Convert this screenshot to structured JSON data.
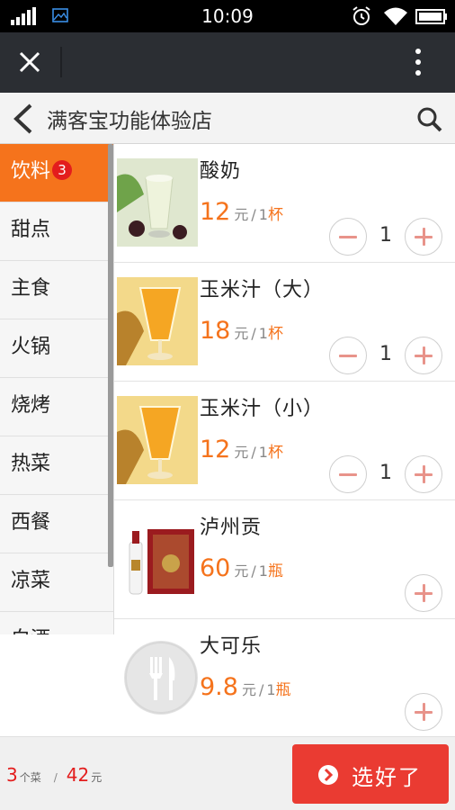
{
  "status_bar": {
    "time": "10:09"
  },
  "store": {
    "title": "满客宝功能体验店"
  },
  "categories": [
    {
      "label": "饮料",
      "badge": "3"
    },
    {
      "label": "甜点"
    },
    {
      "label": "主食"
    },
    {
      "label": "火锅"
    },
    {
      "label": "烧烤"
    },
    {
      "label": "热菜"
    },
    {
      "label": "西餐"
    },
    {
      "label": "凉菜"
    },
    {
      "label": "白酒"
    }
  ],
  "products": [
    {
      "name": "酸奶",
      "price": "12",
      "currency": "元",
      "sep": "/",
      "unit_num": "1",
      "unit_name": "杯",
      "qty": "1"
    },
    {
      "name": "玉米汁（大）",
      "price": "18",
      "currency": "元",
      "sep": "/",
      "unit_num": "1",
      "unit_name": "杯",
      "qty": "1"
    },
    {
      "name": "玉米汁（小）",
      "price": "12",
      "currency": "元",
      "sep": "/",
      "unit_num": "1",
      "unit_name": "杯",
      "qty": "1"
    },
    {
      "name": "泸州贡",
      "price": "60",
      "currency": "元",
      "sep": "/",
      "unit_num": "1",
      "unit_name": "瓶"
    },
    {
      "name": "大可乐",
      "price": "9.8",
      "currency": "元",
      "sep": "/",
      "unit_num": "1",
      "unit_name": "瓶"
    }
  ],
  "cart": {
    "count": "3",
    "count_unit": "个菜",
    "sep": "/",
    "total": "42",
    "total_unit": "元"
  },
  "done_button": {
    "label": "选好了"
  },
  "colors": {
    "accent": "#f5731c",
    "badge": "#e31d1d",
    "done": "#ea3b32",
    "titlebar": "#2b2e33"
  }
}
